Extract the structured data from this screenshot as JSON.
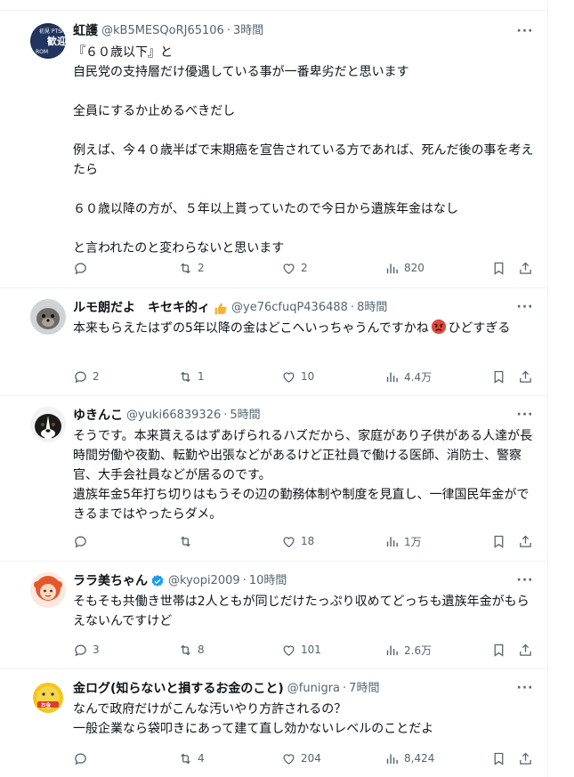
{
  "tweets": [
    {
      "name": "虹護",
      "handle": "@kB5MESQoRJ65106",
      "time": "3時間",
      "text": "『６０歳以下』と\n自民党の支持層だけ優遇している事が一番卑劣だと思います\n\n全員にするか止めるべきだし\n\n例えば、今４０歳半ばで末期癌を宣告されている方であれば、死んだ後の事を考えたら\n\n６０歳以降の方が、５年以上貰っていたので今日から遺族年金はなし\n\nと言われたのと変わらないと思います",
      "reply_count": "",
      "retweet_count": "2",
      "like_count": "2",
      "view_count": "820",
      "avatar_text_top": "初見 PTSH",
      "avatar_text_big": "歓迎",
      "avatar_text_bottom": "ROM"
    },
    {
      "name": "ルモ朗だよ　キセキ的ィ",
      "handle": "@ye76cfuqP436488",
      "time": "8時間",
      "text": "本来もらえたはずの5年以降の金はどこへいっちゃうんですかね",
      "text_tail": "ひどすぎる",
      "reply_count": "2",
      "retweet_count": "1",
      "like_count": "10",
      "view_count": "4.4万"
    },
    {
      "name": "ゆきんこ",
      "handle": "@yuki66839326",
      "time": "5時間",
      "text": "そうです。本来貰えるはずあげられるハズだから、家庭があり子供がある人達が長時間労働や夜勤、転勤や出張などがあるけど正社員で働ける医師、消防士、警察官、大手会社員などが居るのです。\n遺族年金5年打ち切りはもうその辺の勤務体制や制度を見直し、一律国民年金ができるまではやったらダメ。",
      "reply_count": "",
      "retweet_count": "",
      "like_count": "18",
      "view_count": "1万"
    },
    {
      "name": "ララ美ちゃん",
      "handle": "@kyopi2009",
      "time": "10時間",
      "text": "そもそも共働き世帯は2人ともが同じだけたっぷり収めてどっちも遺族年金がもらえないんですけど",
      "reply_count": "3",
      "retweet_count": "8",
      "like_count": "101",
      "view_count": "2.6万"
    },
    {
      "name": "金ログ(知らないと損するお金のこと)",
      "handle": "@funigra",
      "time": "7時間",
      "text": "なんで政府だけがこんな汚いやり方許されるの？\n一般企業なら袋叩きにあって建て直し効かないレベルのことだよ",
      "reply_count": "",
      "retweet_count": "4",
      "like_count": "204",
      "view_count": "8,424",
      "avatar_text": "お金"
    }
  ],
  "labels": {
    "more": "···",
    "dot": "·"
  },
  "colors": {
    "text": "#0f1419",
    "muted": "#536471",
    "border": "#eff3f4",
    "verified": "#1d9bf0"
  }
}
